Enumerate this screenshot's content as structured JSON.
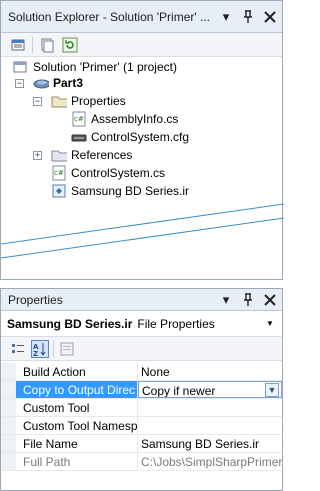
{
  "solution_explorer": {
    "title": "Solution Explorer - Solution 'Primer' ...",
    "pin_icon": "pin-icon",
    "close_icon": "close-icon",
    "toolbar": [
      "properties-icon",
      "show-all-files-icon",
      "refresh-icon"
    ],
    "tree": {
      "solution": "Solution 'Primer' (1 project)",
      "project": "Part3",
      "properties_folder": "Properties",
      "assembly_info": "AssemblyInfo.cs",
      "control_system_cfg": "ControlSystem.cfg",
      "references": "References",
      "control_system_cs": "ControlSystem.cs",
      "ir_file": "Samsung BD Series.ir"
    }
  },
  "properties": {
    "title": "Properties",
    "object_name": "Samsung BD Series.ir",
    "object_type": "File Properties",
    "rows": [
      {
        "key": "Build Action",
        "value": "None"
      },
      {
        "key": "Copy to Output Direc",
        "value": "Copy if newer"
      },
      {
        "key": "Custom Tool",
        "value": ""
      },
      {
        "key": "Custom Tool Namesp",
        "value": ""
      },
      {
        "key": "File Name",
        "value": "Samsung BD Series.ir"
      },
      {
        "key": "Full Path",
        "value": "C:\\Jobs\\SimplSharpPrimer"
      }
    ],
    "colors": {
      "selection": "#3399ff",
      "border": "#9aa8bb",
      "titlebar": "#e8eef6"
    }
  }
}
